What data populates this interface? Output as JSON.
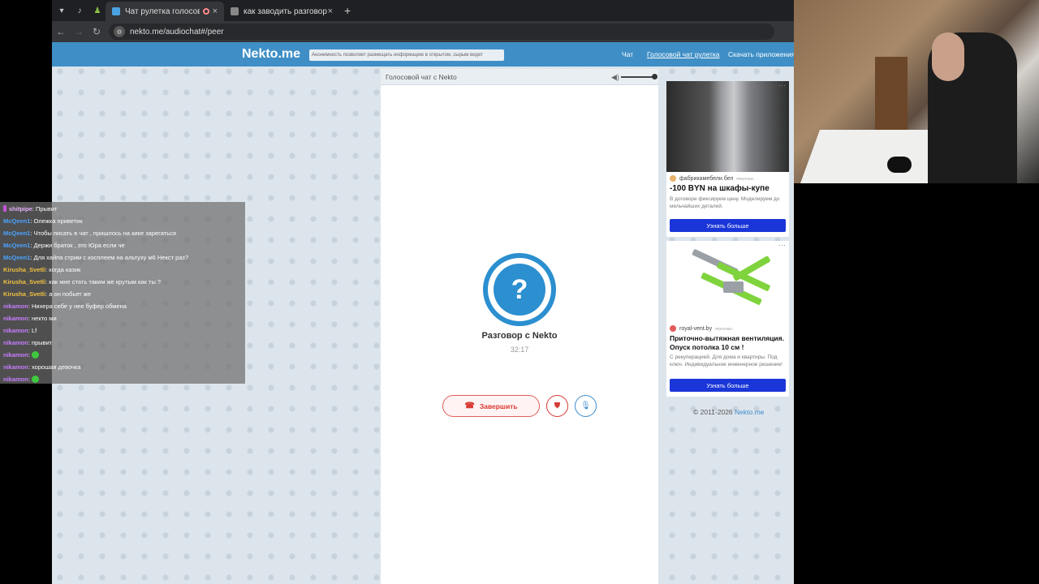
{
  "browser": {
    "tabs": [
      {
        "title": "Чат рулетка голосов",
        "active": true
      },
      {
        "title": "как заводить разговор",
        "active": false
      }
    ],
    "url": "nekto.me/audiochat#/peer",
    "new_tab": "+",
    "tab_close": "×"
  },
  "site": {
    "logo": "Nekto.me",
    "notice": "Анонимность позволяет размещать информацию в открытом, сырым видет",
    "nav": [
      "Чат",
      "Голосовой чат рулетка",
      "Скачать приложения"
    ]
  },
  "chat": {
    "header": "Голосовой чат с Nekto",
    "avatar_symbol": "?",
    "title": "Разговор с Nekto",
    "timer": "32:17",
    "end_label": "Завершить"
  },
  "ads": [
    {
      "source": "фабрикамебели.бел",
      "tag": "РЕКЛАМА",
      "headline": "-100 BYN на шкафы-купе",
      "text": "В договоре фиксируем цену. Моделируем до мельчайших деталей.",
      "button": "Узнать больше"
    },
    {
      "source": "royal-vent.by",
      "tag": "РЕКЛАМА",
      "headline": "Приточно-вытяжная вентиляция. Опуск потолка 10 см !",
      "text": "С рекуперацией. Для дома и квартиры. Под ключ. Индивидуальное инженерное решение!",
      "button": "Узнать больше"
    }
  ],
  "footer": {
    "copyright": "© 2011-2026 ",
    "link": "Nekto.me"
  },
  "stream_chat": [
    {
      "name": "shitpipe",
      "color": "#e6b0ff",
      "text": ": Прывит"
    },
    {
      "name": "McQeen1",
      "color": "#4aa3ff",
      "text": ": Олежка приветик"
    },
    {
      "name": "McQeen1",
      "color": "#4aa3ff",
      "text": ": Чтобы писать в чат , пришлось на кике зарегаться"
    },
    {
      "name": "McQeen1",
      "color": "#4aa3ff",
      "text": ": Держи браток , это Юра если че"
    },
    {
      "name": "McQeen1",
      "color": "#4aa3ff",
      "text": ": Для хайпа стрим с косплеем на альтуху м6 Некст раз?"
    },
    {
      "name": "Kirusha_Svetli",
      "color": "#f0c040",
      "text": ": когда казик"
    },
    {
      "name": "Kirusha_Svetli",
      "color": "#f0c040",
      "text": ": как мне стать таким же крутым как ты ?"
    },
    {
      "name": "Kirusha_Svetli",
      "color": "#f0c040",
      "text": ": а он побьет же"
    },
    {
      "name": "nikamon",
      "color": "#c77dff",
      "text": ": Нихера себе у нее буфер обмена"
    },
    {
      "name": "nikamon",
      "color": "#c77dff",
      "text": ": некто ми"
    },
    {
      "name": "nikamon",
      "color": "#c77dff",
      "text": ": Lf"
    },
    {
      "name": "nikamon",
      "color": "#c77dff",
      "text": ": прывит"
    },
    {
      "name": "nikamon",
      "color": "#c77dff",
      "text": ": ",
      "emote": true
    },
    {
      "name": "nikamon",
      "color": "#c77dff",
      "text": ": хорошая девочка"
    },
    {
      "name": "nikamon",
      "color": "#c77dff",
      "text": ": ",
      "emote": true
    }
  ]
}
